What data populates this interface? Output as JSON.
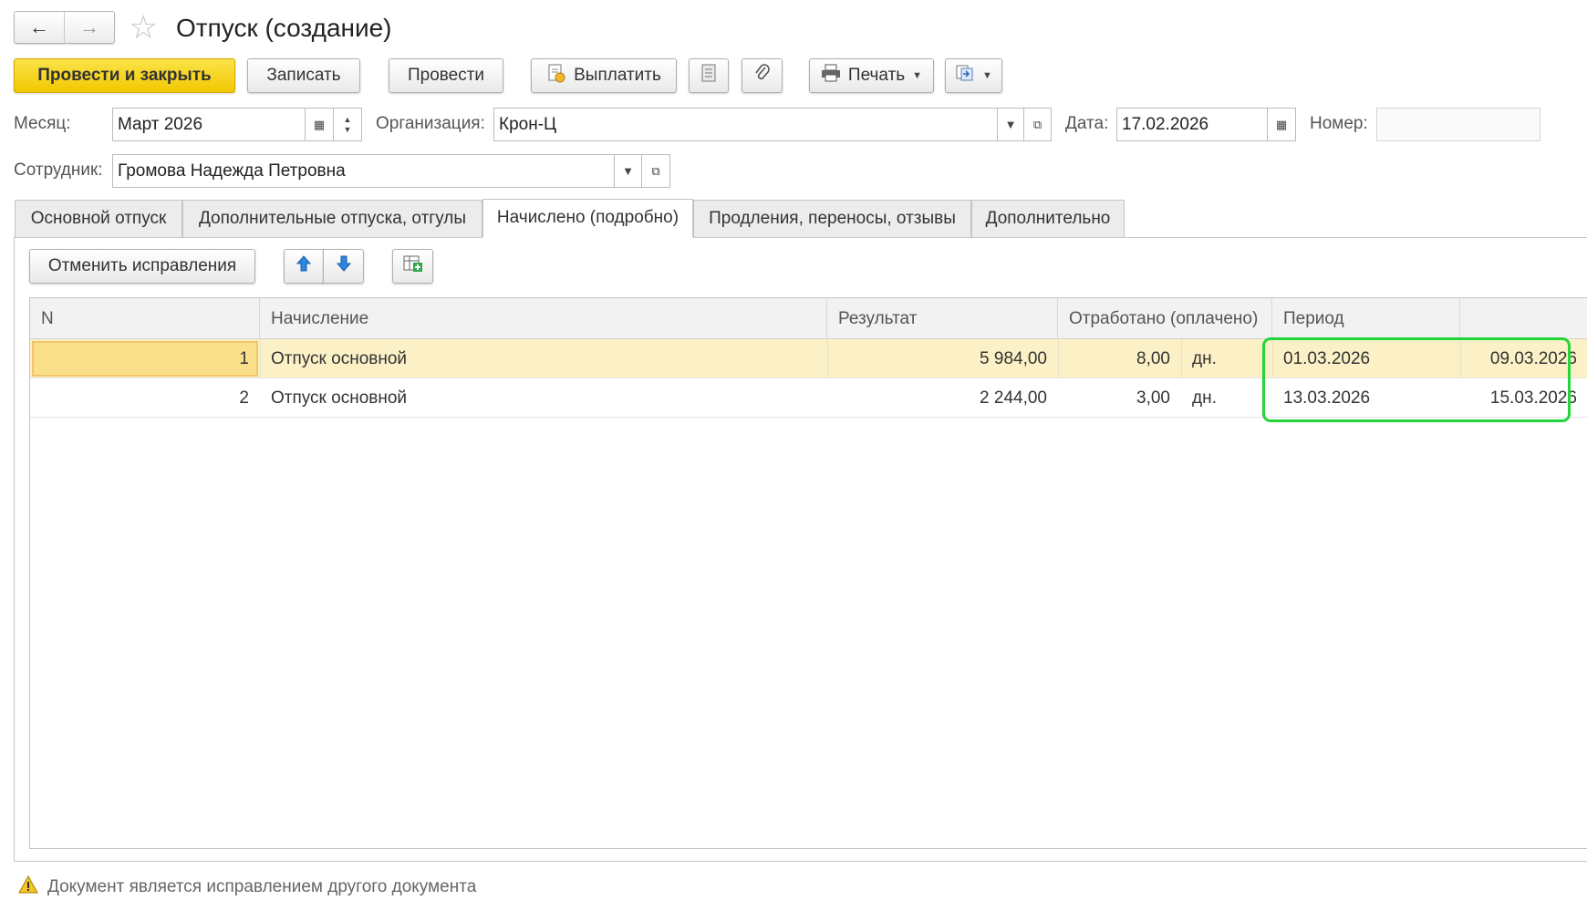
{
  "window": {
    "title": "Отпуск (создание)"
  },
  "toolbar": {
    "post_close": "Провести и закрыть",
    "save": "Записать",
    "post": "Провести",
    "pay": "Выплатить",
    "print": "Печать"
  },
  "form": {
    "month_label": "Месяц:",
    "month_value": "Март 2026",
    "org_label": "Организация:",
    "org_value": "Крон-Ц",
    "date_label": "Дата:",
    "date_value": "17.02.2026",
    "number_label": "Номер:",
    "number_value": "",
    "employee_label": "Сотрудник:",
    "employee_value": "Громова Надежда Петровна"
  },
  "tabs": [
    {
      "label": "Основной отпуск"
    },
    {
      "label": "Дополнительные отпуска, отгулы"
    },
    {
      "label": "Начислено (подробно)"
    },
    {
      "label": "Продления, переносы, отзывы"
    },
    {
      "label": "Дополнительно"
    }
  ],
  "active_tab": "Начислено (подробно)",
  "subtoolbar": {
    "cancel_fix": "Отменить исправления"
  },
  "table": {
    "headers": [
      "N",
      "Начисление",
      "Результат",
      "Отработано (оплачено)",
      "Период"
    ],
    "rows": [
      {
        "n": "1",
        "accrual": "Отпуск основной",
        "result": "5 984,00",
        "worked": "8,00",
        "unit": "дн.",
        "from": "01.03.2026",
        "to": "09.03.2026"
      },
      {
        "n": "2",
        "accrual": "Отпуск основной",
        "result": "2 244,00",
        "worked": "3,00",
        "unit": "дн.",
        "from": "13.03.2026",
        "to": "15.03.2026"
      }
    ]
  },
  "status": {
    "message": "Документ является исправлением другого документа"
  },
  "colors": {
    "primary_button": "#f5d21a",
    "selected_row": "#fcf1c6",
    "highlight": "#22d63a"
  }
}
